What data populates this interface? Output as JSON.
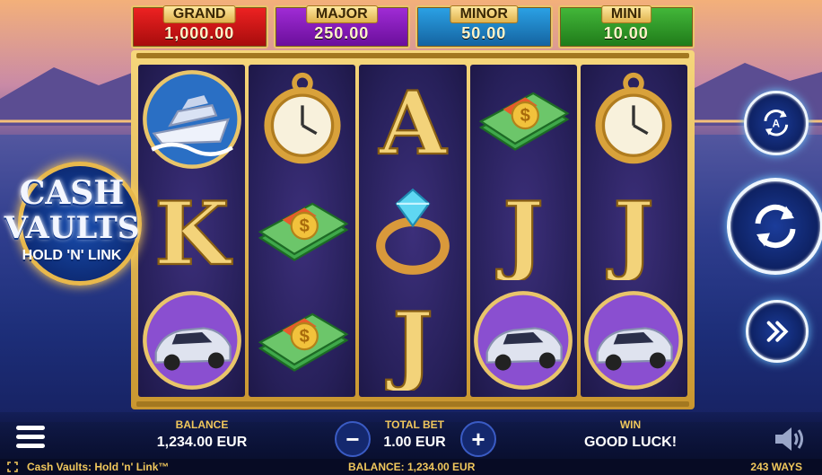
{
  "jackpots": [
    {
      "label": "GRAND",
      "value": "1,000.00"
    },
    {
      "label": "MAJOR",
      "value": "250.00"
    },
    {
      "label": "MINOR",
      "value": "50.00"
    },
    {
      "label": "MINI",
      "value": "10.00"
    }
  ],
  "logo": {
    "line1": "CASH",
    "line2": "VAULTS",
    "line3": "HOLD 'N' LINK"
  },
  "reels": [
    [
      "yacht",
      "K",
      "car"
    ],
    [
      "pocket-watch",
      "cash-stack",
      "cash-stack"
    ],
    [
      "A",
      "diamond-ring",
      "J"
    ],
    [
      "cash-stack",
      "J",
      "car"
    ],
    [
      "pocket-watch",
      "J",
      "car"
    ]
  ],
  "controls": {
    "autoplay_icon": "autoplay-icon",
    "spin_icon": "spin-icon",
    "turbo_icon": "fast-forward-icon",
    "menu_icon": "menu-icon",
    "sound_icon": "speaker-icon"
  },
  "bottom": {
    "balance_label": "BALANCE",
    "balance_value": "1,234.00 EUR",
    "bet_label": "TOTAL BET",
    "bet_value": "1.00 EUR",
    "bet_minus": "−",
    "bet_plus": "+",
    "win_label": "WIN",
    "win_value": "GOOD LUCK!"
  },
  "status": {
    "game_title": "Cash Vaults: Hold 'n' Link™",
    "balance": "BALANCE: 1,234.00 EUR",
    "ways": "243 WAYS"
  },
  "colors": {
    "gold": "#f0c75c",
    "frame": "#e2b650",
    "reel_bg": "#2b2361"
  }
}
